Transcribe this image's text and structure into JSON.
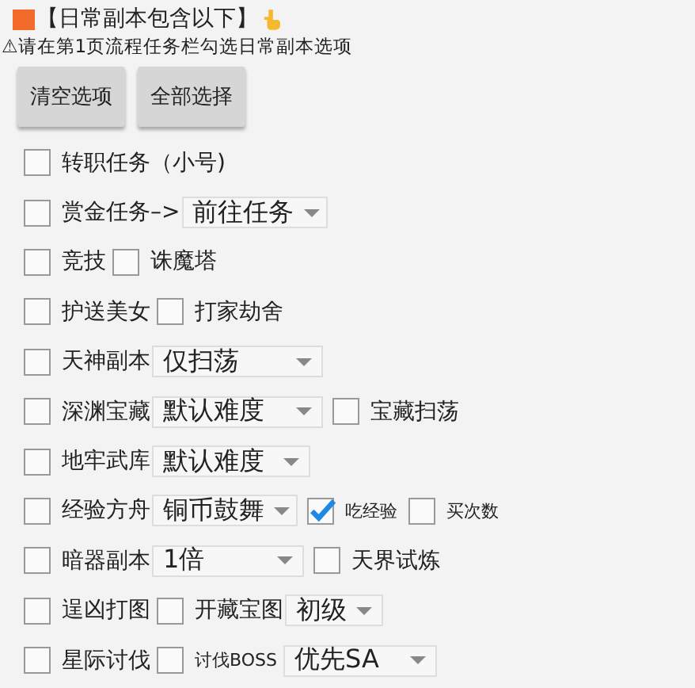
{
  "header": {
    "title": "【日常副本包含以下】",
    "notice": "⚠请在第1页流程任务栏勾选日常副本选项"
  },
  "buttons": [
    "清空选项",
    "全部选择"
  ],
  "rows": [
    {
      "items": [
        {
          "kind": "checkbox",
          "label": "转职任务（小号)",
          "checked": false
        }
      ]
    },
    {
      "items": [
        {
          "kind": "checkbox",
          "label": "赏金任务–>",
          "checked": false
        },
        {
          "kind": "select",
          "value": "前往任务"
        }
      ]
    },
    {
      "items": [
        {
          "kind": "checkbox",
          "label": "竞技",
          "checked": false
        },
        {
          "kind": "checkbox",
          "label": "诛魔塔",
          "checked": false
        }
      ]
    },
    {
      "items": [
        {
          "kind": "checkbox",
          "label": "护送美女",
          "checked": false
        },
        {
          "kind": "checkbox",
          "label": "打家劫舍",
          "checked": false
        }
      ]
    },
    {
      "items": [
        {
          "kind": "checkbox",
          "label": "天神副本",
          "checked": false
        },
        {
          "kind": "select",
          "value": "仅扫荡"
        }
      ]
    },
    {
      "items": [
        {
          "kind": "checkbox",
          "label": "深渊宝藏",
          "checked": false
        },
        {
          "kind": "select",
          "value": "默认难度"
        },
        {
          "kind": "checkbox",
          "label": "宝藏扫荡",
          "checked": false
        }
      ]
    },
    {
      "items": [
        {
          "kind": "checkbox",
          "label": "地牢武库",
          "checked": false
        },
        {
          "kind": "select",
          "value": "默认难度"
        }
      ]
    },
    {
      "items": [
        {
          "kind": "checkbox",
          "label": "经验方舟",
          "checked": false
        },
        {
          "kind": "select",
          "value": "铜币鼓舞"
        },
        {
          "kind": "smallcheckbox",
          "label": "吃经验",
          "checked": true
        },
        {
          "kind": "smallcheckbox",
          "label": "买次数",
          "checked": false
        }
      ]
    },
    {
      "items": [
        {
          "kind": "checkbox",
          "label": "暗器副本",
          "checked": false
        },
        {
          "kind": "select",
          "value": "1倍"
        },
        {
          "kind": "checkbox",
          "label": "天界试炼",
          "checked": false
        }
      ]
    },
    {
      "items": [
        {
          "kind": "checkbox",
          "label": "逞凶打图",
          "checked": false
        },
        {
          "kind": "checkbox",
          "label": "开藏宝图",
          "checked": false
        },
        {
          "kind": "select",
          "value": "初级"
        }
      ]
    },
    {
      "items": [
        {
          "kind": "checkbox",
          "label": "星际讨伐",
          "checked": false
        },
        {
          "kind": "smallcheckbox",
          "label": "讨伐BOSS",
          "checked": false
        },
        {
          "kind": "select",
          "value": "优先SA"
        }
      ]
    }
  ]
}
